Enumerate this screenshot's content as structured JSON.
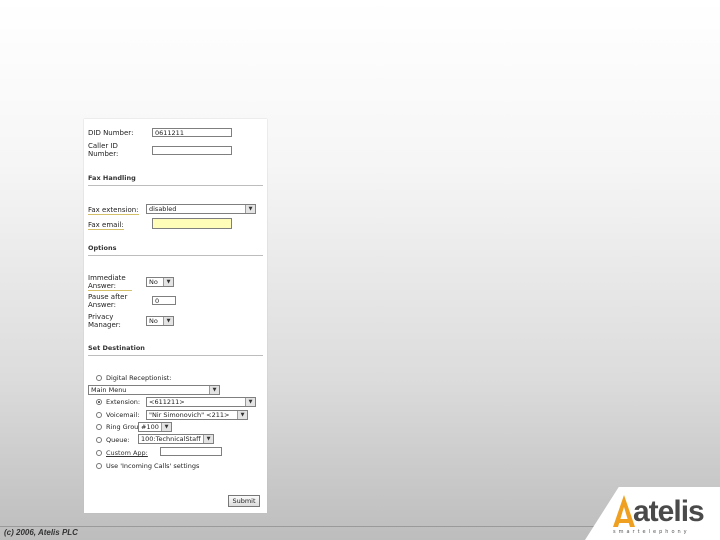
{
  "form": {
    "did_number": {
      "label": "DID Number:",
      "value": "0611211"
    },
    "caller_id": {
      "label": "Caller ID Number:",
      "value": ""
    },
    "fax_section": "Fax Handling",
    "fax_extension": {
      "label": "Fax extension:",
      "value": "disabled"
    },
    "fax_email": {
      "label": "Fax email:",
      "value": ""
    },
    "options_section": "Options",
    "immediate_answer": {
      "label": "Immediate Answer:",
      "value": "No"
    },
    "pause_after_answer": {
      "label": "Pause after Answer:",
      "value": "0"
    },
    "privacy_manager": {
      "label": "Privacy Manager:",
      "value": "No"
    },
    "destination_section": "Set Destination",
    "destinations": {
      "digital_receptionist": {
        "label": "Digital Receptionist:",
        "value": "Main Menu",
        "selected": false
      },
      "extension": {
        "label": "Extension:",
        "value": "<611211>",
        "selected": true
      },
      "voicemail": {
        "label": "Voicemail:",
        "value": "\"Nir Simonovich\" <211>",
        "selected": false
      },
      "ring_group": {
        "label": "Ring Group:",
        "value": "#100",
        "selected": false
      },
      "queue": {
        "label": "Queue:",
        "value": "100:TechnicalStaff",
        "selected": false
      },
      "custom_app": {
        "label": "Custom App:",
        "value": "",
        "selected": false
      },
      "incoming_calls": {
        "label": "Use 'Incoming Calls' settings",
        "selected": false
      }
    },
    "submit_label": "Submit"
  },
  "footer": {
    "copyright": "(c) 2006, Atelis PLC"
  },
  "logo": {
    "name": "atelis",
    "tagline": "smartelephony",
    "accent_color": "#f0a020"
  }
}
